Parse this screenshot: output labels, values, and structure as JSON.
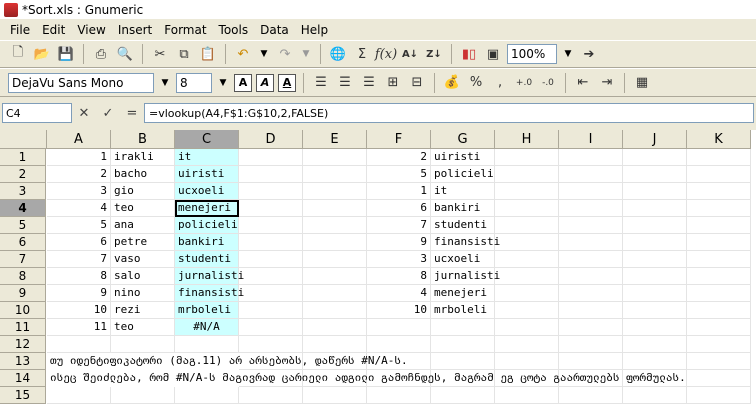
{
  "window": {
    "title": "*Sort.xls : Gnumeric"
  },
  "menu": [
    "File",
    "Edit",
    "View",
    "Insert",
    "Format",
    "Tools",
    "Data",
    "Help"
  ],
  "toolbar": {
    "zoom": "100%"
  },
  "format": {
    "font": "DejaVu Sans Mono",
    "size": "8"
  },
  "formula_bar": {
    "cell_ref": "C4",
    "formula": "=vlookup(A4,F$1:G$10,2,FALSE)"
  },
  "columns": [
    "A",
    "B",
    "C",
    "D",
    "E",
    "F",
    "G",
    "H",
    "I",
    "J",
    "K"
  ],
  "rows": [
    "1",
    "2",
    "3",
    "4",
    "5",
    "6",
    "7",
    "8",
    "9",
    "10",
    "11",
    "12",
    "13",
    "14",
    "15"
  ],
  "left_table": [
    {
      "a": "1",
      "b": "irakli",
      "c": "it"
    },
    {
      "a": "2",
      "b": "bacho",
      "c": "uiristi"
    },
    {
      "a": "3",
      "b": "gio",
      "c": "ucxoeli"
    },
    {
      "a": "4",
      "b": "teo",
      "c": "menejeri"
    },
    {
      "a": "5",
      "b": "ana",
      "c": "policieli"
    },
    {
      "a": "6",
      "b": "petre",
      "c": "bankiri"
    },
    {
      "a": "7",
      "b": "vaso",
      "c": "studenti"
    },
    {
      "a": "8",
      "b": "salo",
      "c": "jurnalisti"
    },
    {
      "a": "9",
      "b": "nino",
      "c": "finansisti"
    },
    {
      "a": "10",
      "b": "rezi",
      "c": "mrboleli"
    },
    {
      "a": "11",
      "b": "teo",
      "c": "#N/A"
    }
  ],
  "right_table": [
    {
      "f": "2",
      "g": "uiristi"
    },
    {
      "f": "5",
      "g": "policieli"
    },
    {
      "f": "1",
      "g": "it"
    },
    {
      "f": "6",
      "g": "bankiri"
    },
    {
      "f": "7",
      "g": "studenti"
    },
    {
      "f": "9",
      "g": "finansisti"
    },
    {
      "f": "3",
      "g": "ucxoeli"
    },
    {
      "f": "8",
      "g": "jurnalisti"
    },
    {
      "f": "4",
      "g": "menejeri"
    },
    {
      "f": "10",
      "g": "mrboleli"
    }
  ],
  "notes": {
    "row13": "თუ იდენტიფიკატორი (მაგ.11) არ არსებობს, დაწერს #N/A-ს.",
    "row14": "ისეც შეიძლება, რომ #N/A-ს მაგივრად ცარიელი ადგილი გამოჩნდეს, მაგრამ ეგ ცოტა გაართულებს ფორმულას."
  }
}
